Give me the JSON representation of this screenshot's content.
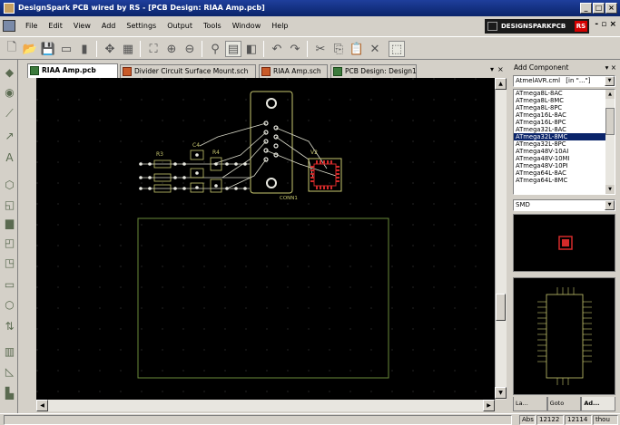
{
  "window": {
    "title": "DesignSpark PCB wired by RS - [PCB Design: RIAA Amp.pcb]"
  },
  "menu": [
    "File",
    "Edit",
    "View",
    "Add",
    "Settings",
    "Output",
    "Tools",
    "Window",
    "Help"
  ],
  "brand": {
    "label": "DESIGNSPARKPCB",
    "rs": "RS"
  },
  "tabs": [
    {
      "label": "RIAA Amp.pcb",
      "kind": "pcb",
      "active": true
    },
    {
      "label": "Divider Circuit Surface Mount.sch",
      "kind": "sch",
      "active": false
    },
    {
      "label": "RIAA Amp.sch",
      "kind": "sch",
      "active": false
    },
    {
      "label": "PCB Design: Design1",
      "kind": "pcb",
      "active": false
    }
  ],
  "canvas": {
    "labels": {
      "r3": "R3",
      "c4": "C4",
      "r4": "R4",
      "v2": "V2",
      "conn1": "CONN1"
    },
    "colors": {
      "board": "#6a8a3a",
      "track": "#d8d8c8",
      "pad": "#e8e8e0",
      "ic_pad": "#d42a2a",
      "silk": "#c8c870"
    }
  },
  "panel": {
    "title": "Add Component",
    "library": "AtmelAVR.cml",
    "filter": "[in \"...\"]",
    "items": [
      "ATmega8L-8AC",
      "ATmega8L-8MC",
      "ATmega8L-8PC",
      "ATmega16L-8AC",
      "ATmega16L-8PC",
      "ATmega32L-8AC",
      "ATmega32L-8MC",
      "ATmega32L-8PC",
      "ATmega48V-10AI",
      "ATmega48V-10MI",
      "ATmega48V-10PI",
      "ATmega64L-8AC",
      "ATmega64L-8MC"
    ],
    "selected_index": 6,
    "package": "SMD",
    "tabs": [
      "La...",
      "Goto",
      "Ad..."
    ]
  },
  "status": {
    "mode": "Abs",
    "x": "12122",
    "y": "12114",
    "units": "thou"
  }
}
